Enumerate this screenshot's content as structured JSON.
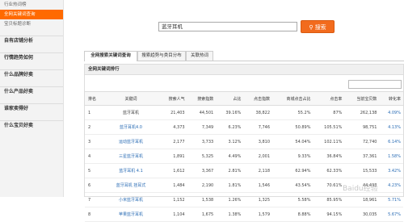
{
  "sidebar": {
    "top_items": [
      "行业热词榜",
      "全网关键词查询",
      "宝贝标题诊断"
    ],
    "sections": [
      "自有店铺分析",
      "行情趋势如何",
      "什么品牌好卖",
      "什么产品好卖",
      "谁家卖得好",
      "什么宝贝好卖"
    ]
  },
  "search": {
    "value": "蓝牙耳机",
    "button_label": "搜索"
  },
  "tabs": [
    "全网搜索关键词查询",
    "搜索趋势与类目分布",
    "关联热词"
  ],
  "panel": {
    "title": "全网关键词排行"
  },
  "table": {
    "headers": [
      "排名",
      "关键词",
      "搜索人气",
      "搜索指数",
      "占比",
      "点击指数",
      "商城点击占比",
      "点击率",
      "当前宝贝数",
      "转化率"
    ],
    "rows": [
      [
        "1",
        "蓝牙耳机",
        "21,403",
        "44,501",
        "39.16%",
        "38,822",
        "55.2%",
        "87%",
        "262,138",
        "4.09%"
      ],
      [
        "2",
        "蓝牙耳机4.0",
        "4,373",
        "7,349",
        "6.23%",
        "7,746",
        "50.89%",
        "105.51%",
        "98,751",
        "4.13%"
      ],
      [
        "3",
        "运动蓝牙耳机",
        "2,177",
        "3,733",
        "3.12%",
        "3,810",
        "54.04%",
        "102.11%",
        "72,740",
        "6.14%"
      ],
      [
        "4",
        "三星蓝牙耳机",
        "1,891",
        "5,325",
        "4.49%",
        "2,001",
        "9.33%",
        "36.84%",
        "37,361",
        "1.58%"
      ],
      [
        "5",
        "蓝牙耳机 4.1",
        "1,612",
        "3,367",
        "2.81%",
        "2,118",
        "62.94%",
        "62.33%",
        "15,533",
        "3.42%"
      ],
      [
        "6",
        "蓝牙耳机 挂耳式",
        "1,484",
        "2,190",
        "1.81%",
        "1,546",
        "43.54%",
        "70.61%",
        "44,498",
        "4.23%"
      ],
      [
        "7",
        "小米蓝牙耳机",
        "1,152",
        "1,538",
        "1.26%",
        "1,325",
        "5.58%",
        "85.95%",
        "18,961",
        "5.71%"
      ],
      [
        "8",
        "苹果蓝牙耳机",
        "1,104",
        "1,675",
        "1.38%",
        "1,579",
        "8.88%",
        "94.15%",
        "30,035",
        "5.67%"
      ]
    ]
  },
  "watermark": "Baidu经验"
}
